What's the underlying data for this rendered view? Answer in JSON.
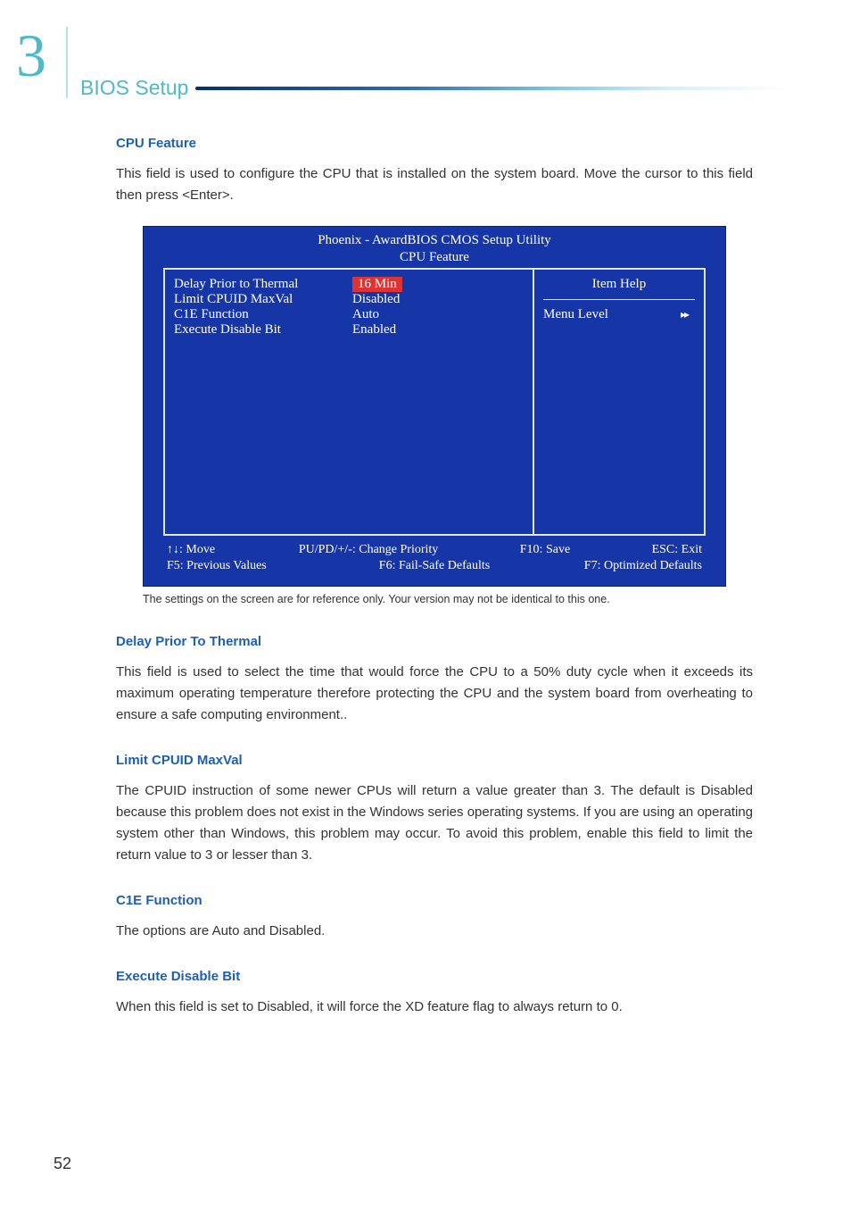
{
  "chapterNumber": "3",
  "sectionTitle": "BIOS Setup",
  "pageNumber": "52",
  "headings": {
    "cpuFeature": "CPU Feature",
    "delayPrior": "Delay Prior To Thermal",
    "limitCpuid": "Limit CPUID MaxVal",
    "c1e": "C1E Function",
    "execDisable": "Execute Disable Bit"
  },
  "body": {
    "cpuFeature": "This field is used to configure the CPU that is installed on the system board. Move the cursor to this field then press <Enter>.",
    "caption": "The settings on the screen are for reference only. Your version may not be identical to this one.",
    "delayPrior": "This field is used to select the time that would force the CPU to a 50% duty cycle when it exceeds its maximum operating temperature therefore protecting the CPU and the system board from overheating to ensure a safe computing environment..",
    "limitCpuid": "The CPUID instruction of some newer CPUs will return a value greater than 3. The default is Disabled because this problem does not exist in the Windows series operating systems. If you are using an operating system other than Windows, this problem may occur. To avoid this problem, enable this field to limit the return value to 3 or lesser than 3.",
    "c1e": "The options are Auto and Disabled.",
    "execDisable": "When this field is set to Disabled, it will force the XD feature flag to always return to 0."
  },
  "bios": {
    "title1": "Phoenix - AwardBIOS CMOS Setup Utility",
    "title2": "CPU Feature",
    "rows": [
      {
        "label": "Delay Prior to Thermal",
        "value": "16 Min",
        "highlight": true
      },
      {
        "label": "Limit CPUID MaxVal",
        "value": "Disabled",
        "highlight": false
      },
      {
        "label": "C1E Function",
        "value": "Auto",
        "highlight": false
      },
      {
        "label": "Execute Disable Bit",
        "value": "Enabled",
        "highlight": false
      }
    ],
    "help": {
      "itemHelp": "Item Help",
      "menuLevel": "Menu Level",
      "arrows": "▸▸"
    },
    "footer": {
      "move": "↑↓: Move",
      "change": "PU/PD/+/-: Change Priority",
      "save": "F10: Save",
      "exit": "ESC: Exit",
      "prev": "F5: Previous Values",
      "failsafe": "F6: Fail-Safe Defaults",
      "optimized": "F7: Optimized Defaults"
    }
  }
}
